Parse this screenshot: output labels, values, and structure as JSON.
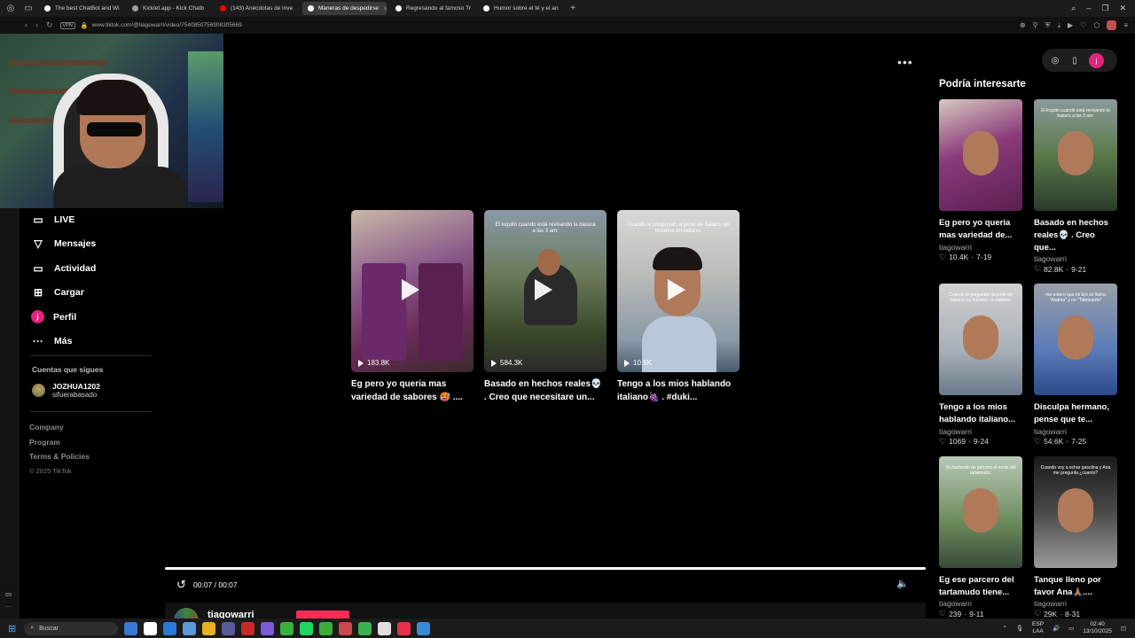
{
  "browser": {
    "tabs": [
      {
        "label": "The best ChatBot and Wi",
        "favicon_color": "#ffffff",
        "active": false
      },
      {
        "label": "Kicklet.app - Kick Chatb",
        "favicon_color": "#9aa0a6",
        "active": false
      },
      {
        "label": "(143) Anécdotas de inve",
        "favicon_color": "#ff0000",
        "active": false
      },
      {
        "label": "Maneras de despedirse",
        "favicon_color": "#ffffff",
        "active": true
      },
      {
        "label": "Regresando al famoso Tr",
        "favicon_color": "#ffffff",
        "active": false
      },
      {
        "label": "Humor sobre el té y el an",
        "favicon_color": "#ffffff",
        "active": false
      }
    ],
    "vpn_label": "VPN",
    "url": "www.tiktok.com/@tiagowarri/video/7540850756908305669"
  },
  "sidebar": {
    "items": [
      {
        "label": "LIVE",
        "icon": "live-icon"
      },
      {
        "label": "Mensajes",
        "icon": "messages-icon"
      },
      {
        "label": "Actividad",
        "icon": "activity-icon"
      },
      {
        "label": "Cargar",
        "icon": "upload-icon"
      },
      {
        "label": "Perfil",
        "icon": "profile-icon"
      },
      {
        "label": "Más",
        "icon": "more-icon"
      }
    ],
    "profile_initial": "j",
    "following_title": "Cuentas que sigues",
    "following": [
      {
        "username": "JOZHUA1202",
        "display": "sifuerabasado"
      }
    ],
    "links": [
      "Company",
      "Program",
      "Terms & Policies"
    ],
    "copyright": "© 2025 TikTok"
  },
  "left_strip": {
    "label1": "ɑx",
    "label2": "..."
  },
  "recommended": [
    {
      "views": "183.8K",
      "title": "Eg pero yo queria mas variedad de sabores 🥵 ....",
      "caption": ""
    },
    {
      "views": "584.3K",
      "title": "Basado en hechos reales💀 . Creo que necesitare un...",
      "caption": "El loquito cuando está revisando la basura a las 3 am:"
    },
    {
      "views": "10.5K",
      "title": "Tengo a los mios hablando italiano🍇 . #duki...",
      "caption": "Cuando le preguntan al profe de italiano los horarios en italiano:"
    }
  ],
  "player": {
    "time": "00:07 / 00:07",
    "progress": 1.0,
    "author": "tiagowarri"
  },
  "right_panel": {
    "title": "Podría interesarte",
    "profile_initial": "j",
    "items": [
      {
        "title": "Eg pero yo queria mas variedad de...",
        "author": "tiagowarri",
        "likes": "10.4K",
        "date": "7-19",
        "caption": ""
      },
      {
        "title": "Basado en hechos reales💀 . Creo que...",
        "author": "tiagowarri",
        "likes": "82.8K",
        "date": "9-21",
        "caption": "El loquito cuando está revisando la basura a las 3 am:"
      },
      {
        "title": "Tengo a los mios hablando italiano...",
        "author": "tiagowarri",
        "likes": "1069",
        "date": "9-24",
        "caption": "Cuando le preguntan al profe de italiano los horarios en italiano:"
      },
      {
        "title": "Disculpa hermano, pense que te...",
        "author": "tiagowarri",
        "likes": "54.6K",
        "date": "7-25",
        "caption": "me entero que mi bro se llama \"Andres\" y no \"Tabmuerto\""
      },
      {
        "title": "Eg ese parcero del tartamudo tiene...",
        "author": "tiagowarri",
        "likes": "239",
        "date": "9-11",
        "caption": "Yo haciendo de parcero el novio del tartamudo:"
      },
      {
        "title": "Tanque lleno por favor Ana🙏🏽....",
        "author": "tiagowarri",
        "likes": "29K",
        "date": "8-31",
        "caption": "Cuando voy a echar gasolina y Ana me pregunta ¿cuanto?"
      }
    ]
  },
  "taskbar": {
    "search_placeholder": "Buscar",
    "lang_line1": "ESP",
    "lang_line2": "LAA",
    "time": "02:40",
    "date": "13/10/2025",
    "app_colors": [
      "#3a78d8",
      "#ffffff",
      "#2a7ad8",
      "#5a9ad8",
      "#e8b020",
      "#5a5a9a",
      "#c82a2a",
      "#7a5ad8",
      "#3ab03a",
      "#1ed760",
      "#3ab03a",
      "#c84a4a",
      "#3ab050",
      "#e0e0e0",
      "#e8304a",
      "#3a8ad8"
    ]
  }
}
